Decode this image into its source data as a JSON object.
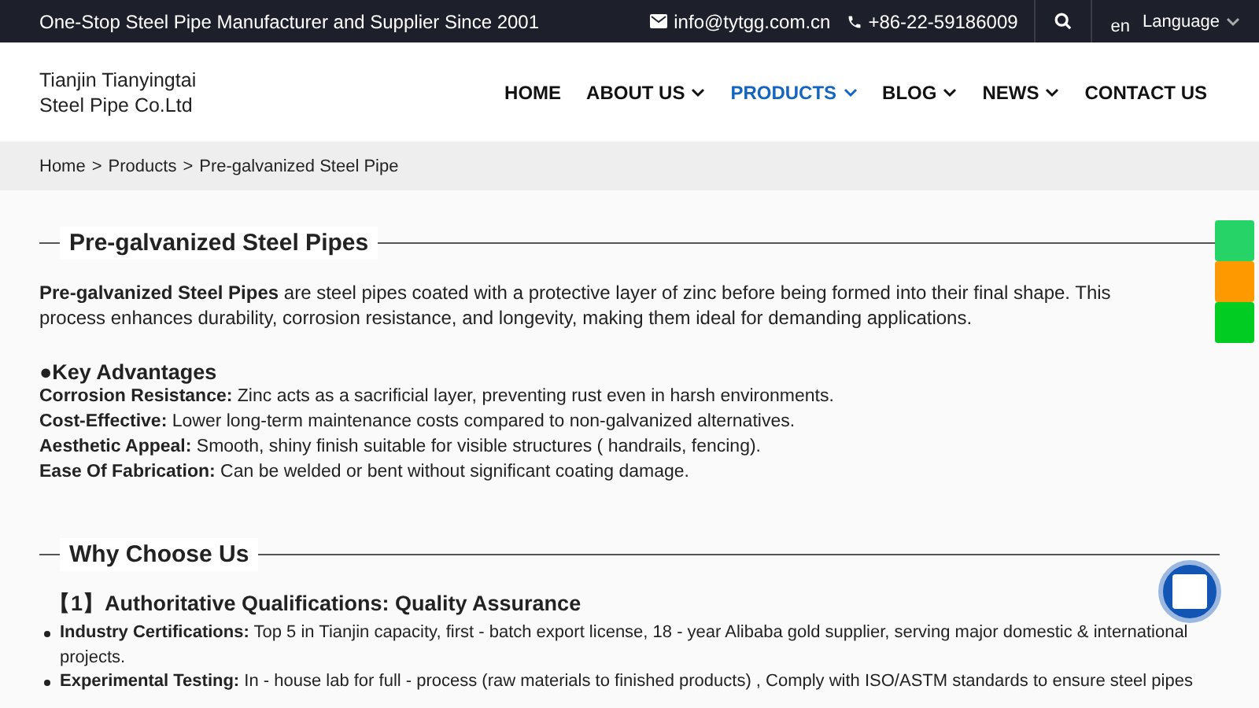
{
  "top_bar": {
    "tagline": "One-Stop Steel Pipe Manufacturer and Supplier Since 2001",
    "email": "info@tytgg.com.cn",
    "phone": "+86-22-59186009",
    "lang_code": "en",
    "lang_label": "Language"
  },
  "header": {
    "company_name": "Tianjin Tianyingtai Steel Pipe Co.Ltd",
    "nav": [
      {
        "label": "HOME",
        "selected": false,
        "dropdown": false
      },
      {
        "label": "ABOUT US",
        "selected": false,
        "dropdown": true
      },
      {
        "label": "PRODUCTS",
        "selected": true,
        "dropdown": true
      },
      {
        "label": "BLOG",
        "selected": false,
        "dropdown": true
      },
      {
        "label": "NEWS",
        "selected": false,
        "dropdown": true
      },
      {
        "label": "CONTACT US",
        "selected": false,
        "dropdown": false
      }
    ]
  },
  "breadcrumb": {
    "separator": ">",
    "items": [
      "Home",
      "Products",
      "Pre-galvanized Steel Pipe"
    ]
  },
  "intro_section": {
    "title": "Pre-galvanized Steel Pipes",
    "paragraph": "**Pre-galvanized Steel Pipes** are steel pipes coated with a protective layer of zinc before being formed into their final shape. This process enhances durability, corrosion resistance, and longevity, making them ideal for demanding applications.",
    "advantages_title": "●Key Advantages",
    "advantages": [
      "**Corrosion Resistance:**  Zinc acts as a sacrificial layer, preventing rust even in harsh environments.",
      "**Cost-Effective:**  Lower long-term maintenance costs compared to non-galvanized alternatives.",
      "**Aesthetic Appeal:**  Smooth, shiny finish suitable for visible structures ( handrails, fencing).",
      "**Ease Of Fabrication:**  Can be welded or bent without significant coating damage."
    ]
  },
  "why_section": {
    "title": "Why Choose Us",
    "subheading": "【1】Authoritative Qualifications: Quality Assurance",
    "bullets": [
      "**Industry Certifications:**  Top 5 in Tianjin capacity, first - batch export license, 18 - year Alibaba gold supplier, serving major domestic & international projects.",
      "**Experimental Testing:**  In - house lab for full - process (raw materials to finished products) ,  Comply with ISO/ASTM standards to ensure steel pipes"
    ]
  },
  "side_buttons": [
    {
      "color": "#25d366"
    },
    {
      "color": "#ff9900"
    },
    {
      "color": "#00cc22"
    }
  ]
}
